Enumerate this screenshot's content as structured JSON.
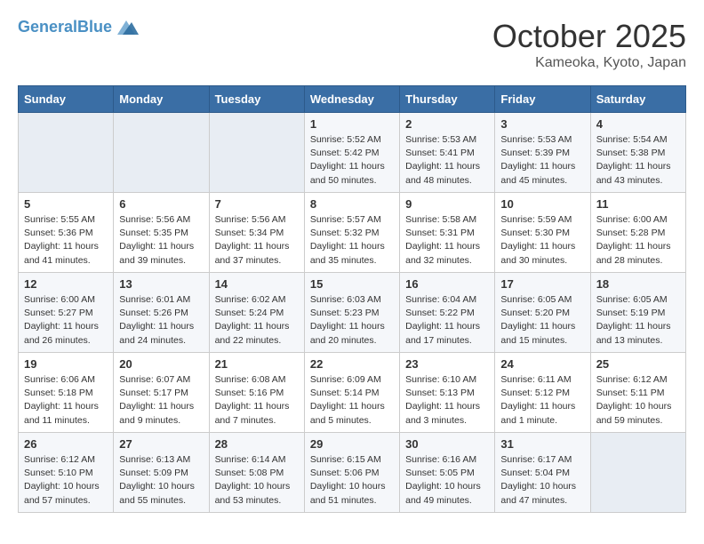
{
  "header": {
    "logo_general": "General",
    "logo_blue": "Blue",
    "title": "October 2025",
    "subtitle": "Kameoka, Kyoto, Japan"
  },
  "days_of_week": [
    "Sunday",
    "Monday",
    "Tuesday",
    "Wednesday",
    "Thursday",
    "Friday",
    "Saturday"
  ],
  "weeks": [
    [
      {
        "day": "",
        "info": ""
      },
      {
        "day": "",
        "info": ""
      },
      {
        "day": "",
        "info": ""
      },
      {
        "day": "1",
        "info": "Sunrise: 5:52 AM\nSunset: 5:42 PM\nDaylight: 11 hours and 50 minutes."
      },
      {
        "day": "2",
        "info": "Sunrise: 5:53 AM\nSunset: 5:41 PM\nDaylight: 11 hours and 48 minutes."
      },
      {
        "day": "3",
        "info": "Sunrise: 5:53 AM\nSunset: 5:39 PM\nDaylight: 11 hours and 45 minutes."
      },
      {
        "day": "4",
        "info": "Sunrise: 5:54 AM\nSunset: 5:38 PM\nDaylight: 11 hours and 43 minutes."
      }
    ],
    [
      {
        "day": "5",
        "info": "Sunrise: 5:55 AM\nSunset: 5:36 PM\nDaylight: 11 hours and 41 minutes."
      },
      {
        "day": "6",
        "info": "Sunrise: 5:56 AM\nSunset: 5:35 PM\nDaylight: 11 hours and 39 minutes."
      },
      {
        "day": "7",
        "info": "Sunrise: 5:56 AM\nSunset: 5:34 PM\nDaylight: 11 hours and 37 minutes."
      },
      {
        "day": "8",
        "info": "Sunrise: 5:57 AM\nSunset: 5:32 PM\nDaylight: 11 hours and 35 minutes."
      },
      {
        "day": "9",
        "info": "Sunrise: 5:58 AM\nSunset: 5:31 PM\nDaylight: 11 hours and 32 minutes."
      },
      {
        "day": "10",
        "info": "Sunrise: 5:59 AM\nSunset: 5:30 PM\nDaylight: 11 hours and 30 minutes."
      },
      {
        "day": "11",
        "info": "Sunrise: 6:00 AM\nSunset: 5:28 PM\nDaylight: 11 hours and 28 minutes."
      }
    ],
    [
      {
        "day": "12",
        "info": "Sunrise: 6:00 AM\nSunset: 5:27 PM\nDaylight: 11 hours and 26 minutes."
      },
      {
        "day": "13",
        "info": "Sunrise: 6:01 AM\nSunset: 5:26 PM\nDaylight: 11 hours and 24 minutes."
      },
      {
        "day": "14",
        "info": "Sunrise: 6:02 AM\nSunset: 5:24 PM\nDaylight: 11 hours and 22 minutes."
      },
      {
        "day": "15",
        "info": "Sunrise: 6:03 AM\nSunset: 5:23 PM\nDaylight: 11 hours and 20 minutes."
      },
      {
        "day": "16",
        "info": "Sunrise: 6:04 AM\nSunset: 5:22 PM\nDaylight: 11 hours and 17 minutes."
      },
      {
        "day": "17",
        "info": "Sunrise: 6:05 AM\nSunset: 5:20 PM\nDaylight: 11 hours and 15 minutes."
      },
      {
        "day": "18",
        "info": "Sunrise: 6:05 AM\nSunset: 5:19 PM\nDaylight: 11 hours and 13 minutes."
      }
    ],
    [
      {
        "day": "19",
        "info": "Sunrise: 6:06 AM\nSunset: 5:18 PM\nDaylight: 11 hours and 11 minutes."
      },
      {
        "day": "20",
        "info": "Sunrise: 6:07 AM\nSunset: 5:17 PM\nDaylight: 11 hours and 9 minutes."
      },
      {
        "day": "21",
        "info": "Sunrise: 6:08 AM\nSunset: 5:16 PM\nDaylight: 11 hours and 7 minutes."
      },
      {
        "day": "22",
        "info": "Sunrise: 6:09 AM\nSunset: 5:14 PM\nDaylight: 11 hours and 5 minutes."
      },
      {
        "day": "23",
        "info": "Sunrise: 6:10 AM\nSunset: 5:13 PM\nDaylight: 11 hours and 3 minutes."
      },
      {
        "day": "24",
        "info": "Sunrise: 6:11 AM\nSunset: 5:12 PM\nDaylight: 11 hours and 1 minute."
      },
      {
        "day": "25",
        "info": "Sunrise: 6:12 AM\nSunset: 5:11 PM\nDaylight: 10 hours and 59 minutes."
      }
    ],
    [
      {
        "day": "26",
        "info": "Sunrise: 6:12 AM\nSunset: 5:10 PM\nDaylight: 10 hours and 57 minutes."
      },
      {
        "day": "27",
        "info": "Sunrise: 6:13 AM\nSunset: 5:09 PM\nDaylight: 10 hours and 55 minutes."
      },
      {
        "day": "28",
        "info": "Sunrise: 6:14 AM\nSunset: 5:08 PM\nDaylight: 10 hours and 53 minutes."
      },
      {
        "day": "29",
        "info": "Sunrise: 6:15 AM\nSunset: 5:06 PM\nDaylight: 10 hours and 51 minutes."
      },
      {
        "day": "30",
        "info": "Sunrise: 6:16 AM\nSunset: 5:05 PM\nDaylight: 10 hours and 49 minutes."
      },
      {
        "day": "31",
        "info": "Sunrise: 6:17 AM\nSunset: 5:04 PM\nDaylight: 10 hours and 47 minutes."
      },
      {
        "day": "",
        "info": ""
      }
    ]
  ]
}
